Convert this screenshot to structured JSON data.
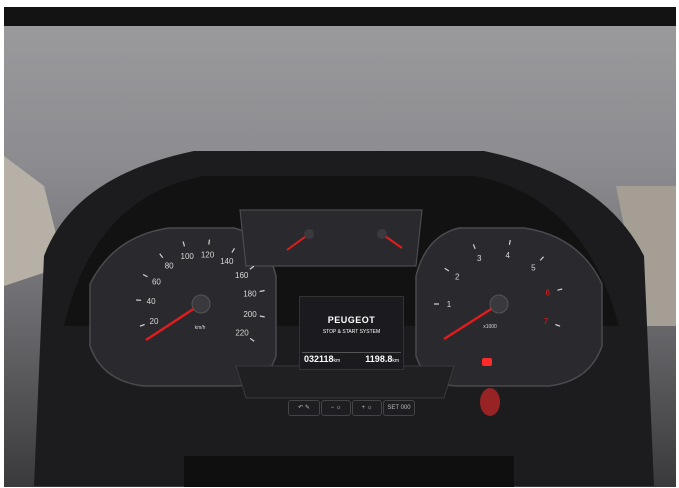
{
  "cluster": {
    "brand": "PEUGEOT",
    "display_subtitle": "STOP & START SYSTEM",
    "odometer": "032118",
    "odometer_unit": "km",
    "trip": "1198.8",
    "trip_unit": "km",
    "speed_unit": "km/h",
    "rpm_unit": "x1000",
    "speed_ticks": [
      "20",
      "40",
      "60",
      "80",
      "100",
      "120",
      "140",
      "160",
      "180",
      "200",
      "220"
    ],
    "rpm_ticks": [
      "1",
      "2",
      "3",
      "4",
      "5",
      "6",
      "7"
    ],
    "buttons": [
      "SET 000"
    ]
  },
  "colors": {
    "needle": "#e21c1c",
    "warning_light": "#ff2a2a",
    "display_background": "#1b1b1f"
  }
}
